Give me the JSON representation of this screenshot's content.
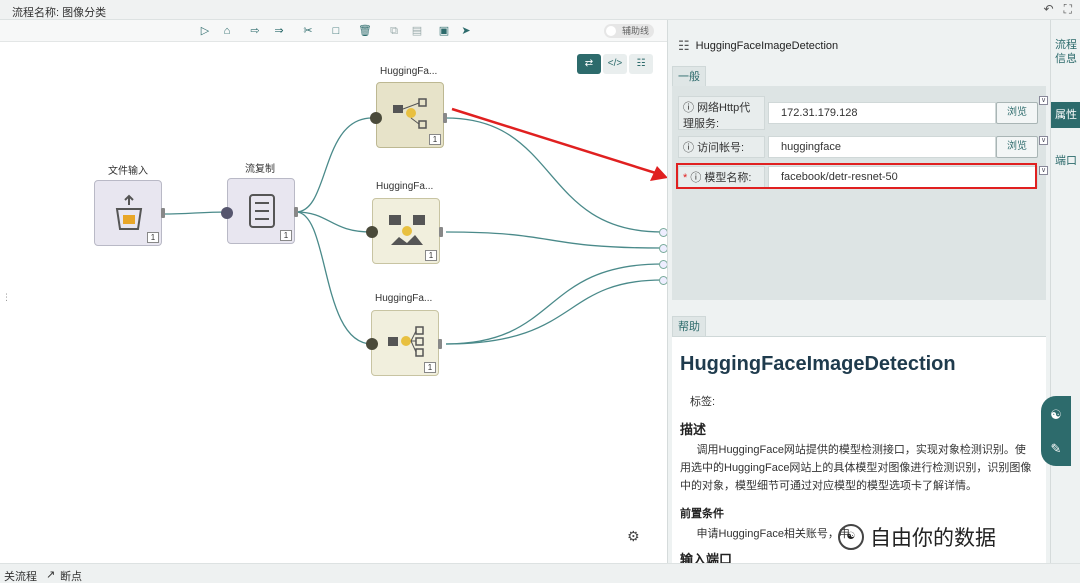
{
  "titlebar": {
    "title": "流程名称: 图像分类",
    "undo_icon": "undo-icon",
    "expand_icon": "expand-icon"
  },
  "toolbar": {
    "aux_label": "辅助线"
  },
  "canvas": {
    "nodes": {
      "file_input": {
        "label": "文件输入",
        "count": "1"
      },
      "stream_copy": {
        "label": "流复制",
        "count": "1"
      },
      "hf1": {
        "label": "HuggingFa...",
        "count": "1"
      },
      "hf2": {
        "label": "HuggingFa...",
        "count": "1"
      },
      "hf3": {
        "label": "HuggingFa...",
        "count": "1"
      }
    }
  },
  "bottombar": {
    "flow_label": "关流程",
    "breakpoint_label": "断点"
  },
  "panel": {
    "header": "HuggingFaceImageDetection",
    "general_tab": "一般",
    "props": [
      {
        "label": "网络Http代理服务:",
        "value": "172.31.179.128",
        "button": "浏览"
      },
      {
        "label": "访问帐号:",
        "value": "huggingface",
        "button": "浏览"
      },
      {
        "label": "模型名称:",
        "value": "facebook/detr-resnet-50",
        "required": "*"
      }
    ],
    "help_tab": "帮助",
    "help": {
      "title": "HuggingFaceImageDetection",
      "tags": "标签:",
      "desc_h": "描述",
      "desc": "调用HuggingFace网站提供的模型检测接口，实现对象检测识别。使用选中的HuggingFace网站上的具体模型对图像进行检测识别，识别图像中的对象，模型细节可通过对应模型的模型选项卡了解详情。",
      "pre_h": "前置条件",
      "pre": "申请HuggingFace相关账号，申",
      "input_h": "输入端口"
    }
  },
  "vtabs": [
    "流程信息",
    "属性",
    "端口"
  ],
  "watermark": "自由你的数据",
  "colors": {
    "accent": "#2d6b6c",
    "highlight": "#e02020"
  }
}
